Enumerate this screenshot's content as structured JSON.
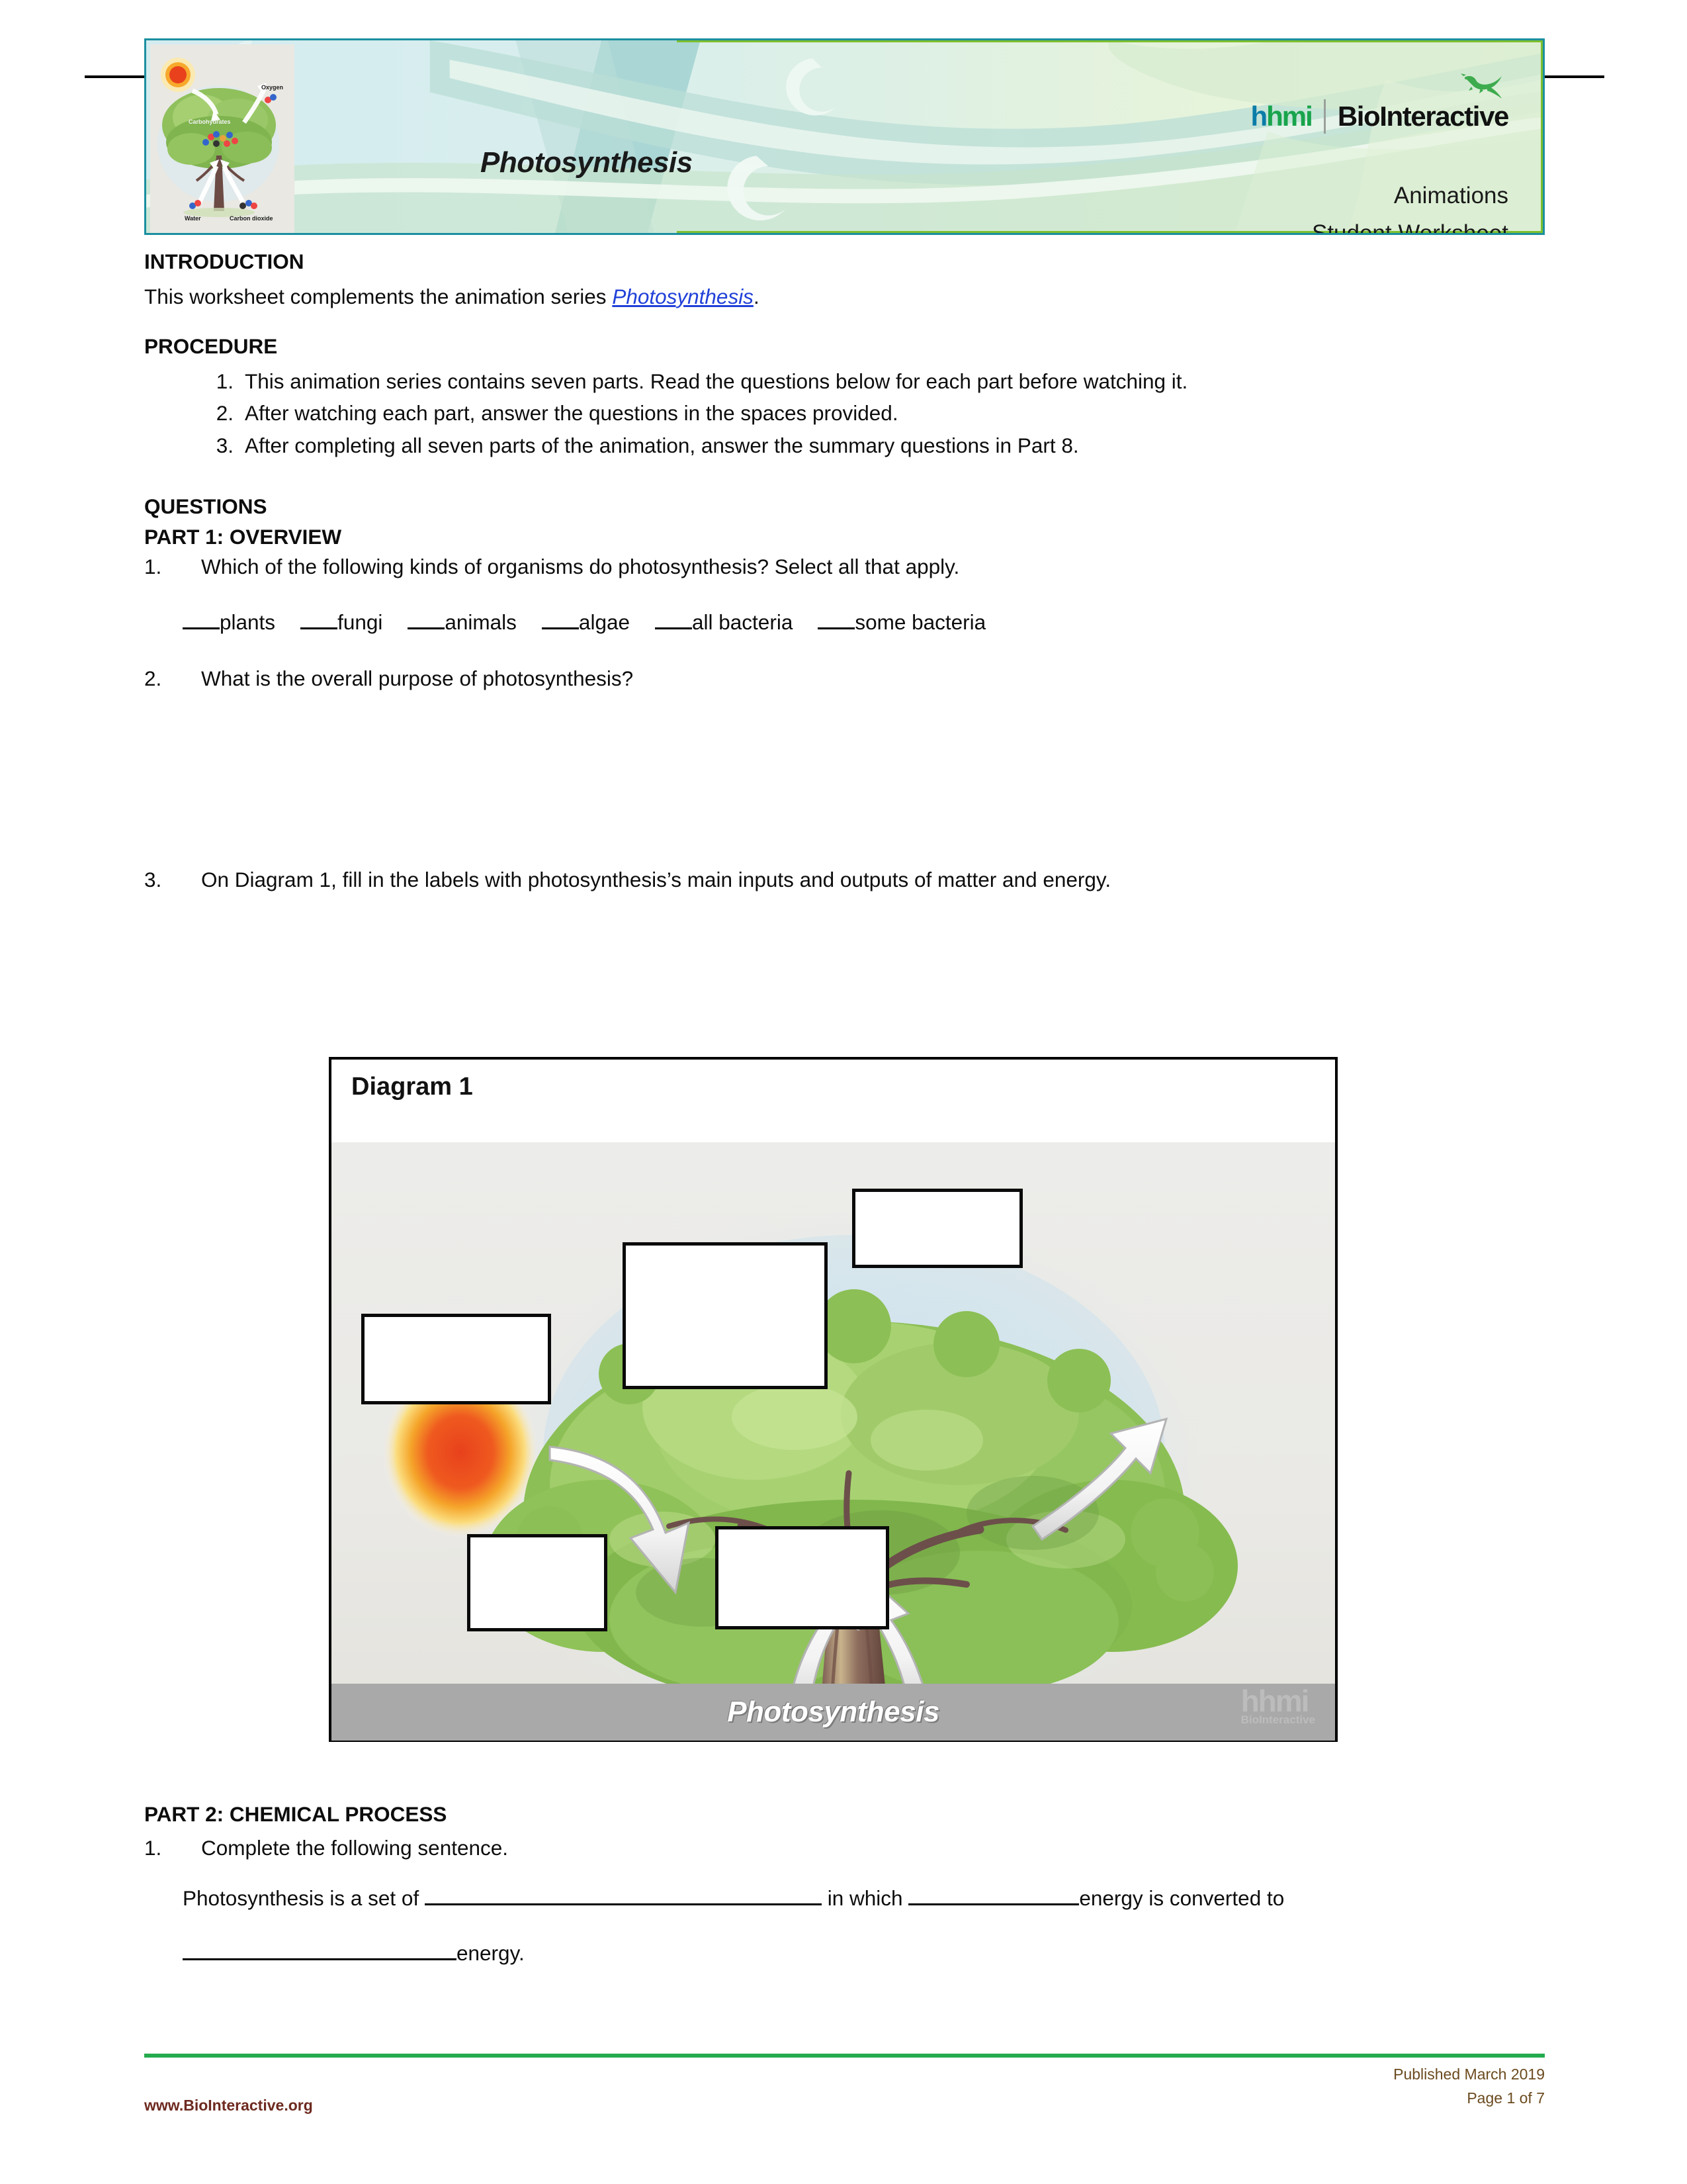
{
  "header": {
    "title": "Photosynthesis",
    "brand": {
      "hhmi_h1": "h",
      "hhmi_h2": "h",
      "hhmi_m": "m",
      "hhmi_i": "i",
      "biointeractive": "BioInteractive"
    },
    "subtitle_line1": "Animations",
    "subtitle_line2": "Student Worksheet",
    "thumbnail_labels": {
      "oxygen": "Oxygen",
      "carbohydrates": "Carbohydrates",
      "water": "Water",
      "carbon_dioxide": "Carbon dioxide"
    },
    "accent_teal": "#1b8fa0",
    "accent_green": "#7fbf2f"
  },
  "introduction": {
    "heading": "INTRODUCTION",
    "text_before_link": "This worksheet complements the animation series ",
    "link_text": "Photosynthesis",
    "text_after_link": "."
  },
  "procedure": {
    "heading": "PROCEDURE",
    "items": [
      {
        "num": "1.",
        "text": "This animation series contains seven parts. Read the questions below for each part before watching it."
      },
      {
        "num": "2.",
        "text": "After watching each part, answer the questions in the spaces provided."
      },
      {
        "num": "3.",
        "text": "After completing all seven parts of the animation, answer the summary questions in Part 8."
      }
    ]
  },
  "questions": {
    "heading": "QUESTIONS",
    "part1": {
      "heading": "PART 1: OVERVIEW",
      "q1": {
        "num": "1.",
        "text": "Which of the following kinds of organisms do photosynthesis? Select all that apply.",
        "choices": [
          "plants",
          "fungi",
          "animals",
          "algae",
          "all bacteria",
          "some bacteria"
        ]
      },
      "q2": {
        "num": "2.",
        "text": "What is the overall purpose of photosynthesis?"
      },
      "q3": {
        "num": "3.",
        "text": "On Diagram 1, fill in the labels with photosynthesis’s main inputs and outputs of matter and energy."
      }
    },
    "part2": {
      "heading": "PART 2: CHEMICAL PROCESS",
      "q1_num": "1.",
      "q1_text": "Complete the following sentence.",
      "sentence_part1": "Photosynthesis is a set of",
      "sentence_part2": "in which",
      "sentence_part3": "energy is converted to",
      "sentence_part4": "energy."
    }
  },
  "diagram": {
    "title": "Diagram 1",
    "caption": "Photosynthesis",
    "watermark": "hhmi",
    "watermark_sub": "BioInteractive",
    "blank_label_count": 5
  },
  "footer": {
    "website": "www.BioInteractive.org",
    "published": "Published March 2019",
    "page": "Page 1 of 7"
  }
}
